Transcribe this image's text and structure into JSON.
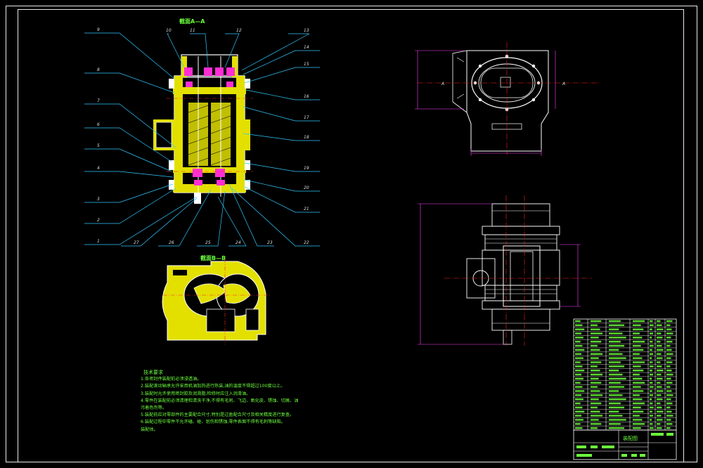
{
  "drawing": {
    "section_aa_title": "截面A—A",
    "section_bb_title": "截面B—B",
    "callouts_left": [
      "9",
      "8",
      "7",
      "6",
      "5",
      "4",
      "3",
      "2",
      "1"
    ],
    "callouts_top": [
      "10",
      "11",
      "12",
      "13"
    ],
    "callouts_right": [
      "14",
      "15",
      "16",
      "17",
      "18",
      "19",
      "20",
      "21",
      "22"
    ],
    "callouts_bottom": [
      "27",
      "26",
      "25",
      "24",
      "23"
    ],
    "view_label_a": "A",
    "notes_title": "技术要求",
    "notes": [
      "1.各密封件装配前必须浸透油。",
      "2.装配滚动轴承允许采用机油加热进行热装,油的温度不得超过100度以上。",
      "3.装配时允许使用密封胶及润滑脂,检修时应注入润滑油。",
      "4.零件在装配前必须清理和清洗干净,不得有毛刺、飞边、氧化皮、锈蚀、切屑、油",
      "污着色剂等。",
      "5.装配前应对零部件的主要配合尺寸,特别是过盈配合尺寸及相关精度进行复查。",
      "6.装配过程中零件不允许磕、碰、划伤和锈蚀,零件表面不得有毛刺等缺陷。",
      "装配体。"
    ]
  },
  "title_block": {
    "drawing_name": "装配图"
  },
  "colors": {
    "frame": "#e8e8e8",
    "outline": "#ffffff",
    "section_fill": "#e3e000",
    "bearing": "#ff2dd4",
    "leader": "#30c8ff",
    "centerline": "#ff2020",
    "dimension": "#ff40ff",
    "text": "#6cff3c"
  }
}
